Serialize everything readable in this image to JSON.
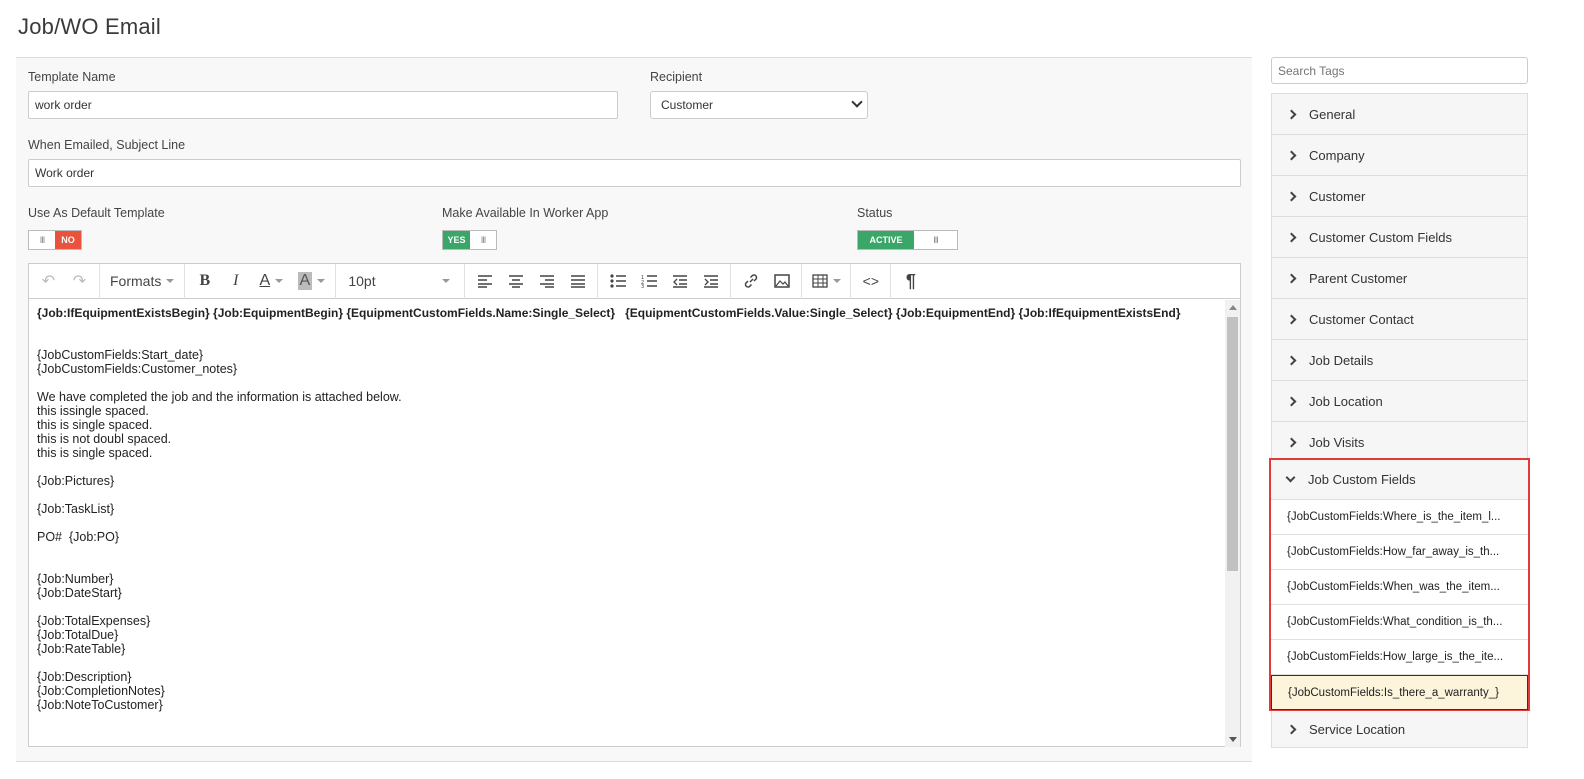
{
  "page": {
    "title": "Job/WO Email"
  },
  "form": {
    "template_name_label": "Template Name",
    "template_name_value": "work order",
    "recipient_label": "Recipient",
    "recipient_value": "Customer",
    "subject_label": "When Emailed, Subject Line",
    "subject_value": "Work order",
    "default_label": "Use As Default Template",
    "default_toggle": {
      "grip": "III",
      "state": "NO"
    },
    "worker_app_label": "Make Available In Worker App",
    "worker_app_toggle": {
      "state": "YES",
      "grip": "III"
    },
    "status_label": "Status",
    "status_toggle": {
      "state": "ACTIVE",
      "grip": "III"
    }
  },
  "toolbar": {
    "formats": "Formats",
    "font_size": "10pt"
  },
  "editor": {
    "lines": [
      "{Job:IfEquipmentExistsBegin} {Job:EquipmentBegin} {EquipmentCustomFields.Name:Single_Select}   {EquipmentCustomFields.Value:Single_Select} {Job:EquipmentEnd} {Job:IfEquipmentExistsEnd}",
      "{JobCustomFields:Start_date}",
      "{JobCustomFields:Customer_notes}",
      "We have completed the job and the information is attached below.",
      "this issingle spaced.",
      "this is single spaced.",
      "this is not doubl spaced.",
      "this is single spaced.",
      "{Job:Pictures}",
      "{Job:TaskList}",
      "PO#  {Job:PO}",
      "{Job:Number}",
      "{Job:DateStart}",
      "{Job:TotalExpenses}",
      "{Job:TotalDue}",
      "{Job:RateTable}",
      "{Job:Description}",
      "{Job:CompletionNotes}",
      "{Job:NoteToCustomer}"
    ]
  },
  "sidebar": {
    "search_placeholder": "Search Tags",
    "categories": [
      "General",
      "Company",
      "Customer",
      "Customer Custom Fields",
      "Parent Customer",
      "Customer Contact",
      "Job Details",
      "Job Location",
      "Job Visits"
    ],
    "expanded": {
      "label": "Job Custom Fields",
      "items": [
        "{JobCustomFields:Where_is_the_item_l...",
        "{JobCustomFields:How_far_away_is_th...",
        "{JobCustomFields:When_was_the_item...",
        "{JobCustomFields:What_condition_is_th...",
        "{JobCustomFields:How_large_is_the_ite...",
        "{JobCustomFields:Is_there_a_warranty_}"
      ]
    },
    "last_category": "Service Location"
  },
  "colors": {
    "no_toggle": "#e9533d",
    "yes_toggle": "#3aa667",
    "highlight_border": "#e03a3a",
    "active_item_bg": "#fcf5dc"
  }
}
